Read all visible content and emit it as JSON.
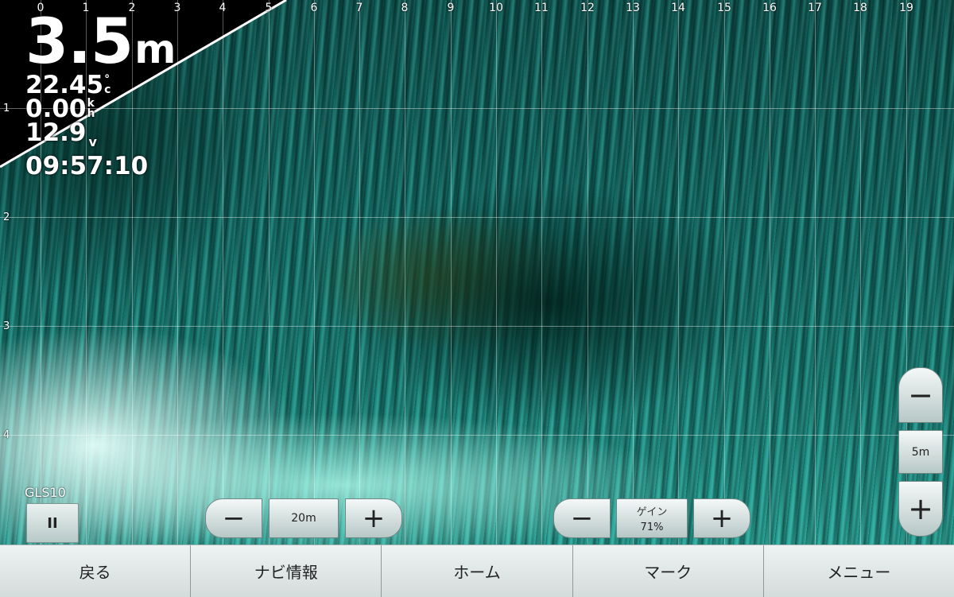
{
  "readout": {
    "depth_value": "3.5",
    "depth_unit": "m",
    "water_temp": "22.45",
    "water_temp_unit_top": "°",
    "water_temp_unit_bottom": "c",
    "speed": "0.00",
    "speed_unit_top": "k",
    "speed_unit_bottom": "h",
    "voltage": "12.9",
    "voltage_unit": "v",
    "time": "09:57:10"
  },
  "scale": {
    "x_labels": [
      "0",
      "1",
      "2",
      "3",
      "4",
      "5",
      "6",
      "7",
      "8",
      "9",
      "10",
      "11",
      "12",
      "13",
      "14",
      "15",
      "16",
      "17",
      "18",
      "19"
    ],
    "y_labels": [
      "1",
      "2",
      "3",
      "4"
    ]
  },
  "source_label": "GLS10",
  "pause_button_glyph": "II",
  "range_control": {
    "minus": "−",
    "value": "20m",
    "plus": "+"
  },
  "gain_control": {
    "minus": "−",
    "title": "ゲイン",
    "value": "71%",
    "plus": "+"
  },
  "vertical_zoom": {
    "minus": "−",
    "value": "5m",
    "plus": "+"
  },
  "bottom_bar": {
    "back": "戻る",
    "nav_info": "ナビ情報",
    "home": "ホーム",
    "mark": "マーク",
    "menu": "メニュー"
  },
  "colors": {
    "sonar_teal": "#1a857c",
    "button_face": "#d4dcdb"
  }
}
